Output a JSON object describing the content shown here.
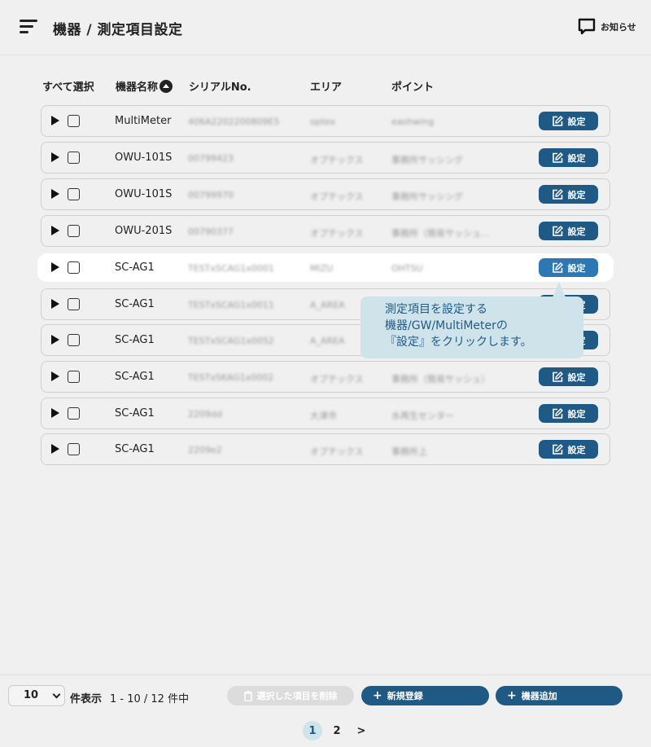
{
  "header": {
    "title": "機器 / 測定項目設定",
    "notice_label": "お知らせ"
  },
  "columns": {
    "select_all": "すべて選択",
    "device_name": "機器名称",
    "serial": "シリアルNo.",
    "area": "エリア",
    "point": "ポイント"
  },
  "set_label": "設定",
  "rows": [
    {
      "name": "MultiMeter",
      "serial": "406A2202200809E5",
      "area": "optex",
      "point": "eashwing"
    },
    {
      "name": "OWU-101S",
      "serial": "00799423",
      "area": "オプテックス",
      "point": "事務所サッシング"
    },
    {
      "name": "OWU-101S",
      "serial": "00799970",
      "area": "オプテックス",
      "point": "事務所サッシング"
    },
    {
      "name": "OWU-201S",
      "serial": "00790377",
      "area": "オプテックス",
      "point": "事務所（簡易サッシュ..."
    },
    {
      "name": "SC-AG1",
      "serial": "TESTxSCAG1x0001",
      "area": "MIZU",
      "point": "OHTSU"
    },
    {
      "name": "SC-AG1",
      "serial": "TESTxSCAG1x0011",
      "area": "A_AREA",
      "point": ""
    },
    {
      "name": "SC-AG1",
      "serial": "TESTxSCAG1x0052",
      "area": "A_AREA",
      "point": ""
    },
    {
      "name": "SC-AG1",
      "serial": "TESTxSKAG1x0002",
      "area": "オプテックス",
      "point": "事務所（簡易サッシュ）"
    },
    {
      "name": "SC-AG1",
      "serial": "2209dd",
      "area": "大津市",
      "point": "水再生センター"
    },
    {
      "name": "SC-AG1",
      "serial": "2209e2",
      "area": "オプテックス",
      "point": "事務所上"
    }
  ],
  "tooltip": {
    "line1": "測定項目を設定する",
    "line2": "機器/GW/MultiMeterの",
    "line3": "『設定』をクリックします。"
  },
  "footer": {
    "per_page_value": "10",
    "per_page_label": "件表示",
    "range_text": "1 - 10 / 12 件中",
    "delete_label": "選択した項目を削除",
    "new_label": "新規登録",
    "add_device_label": "機器追加"
  },
  "pagination": {
    "page1": "1",
    "page2": "2",
    "next": ">"
  },
  "colors": {
    "primary": "#1f5a87",
    "tooltip_bg": "#cfe3ea"
  }
}
